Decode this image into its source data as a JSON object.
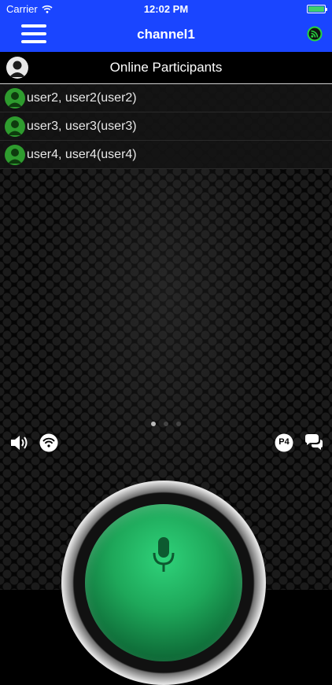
{
  "status_bar": {
    "carrier": "Carrier",
    "time": "12:02 PM"
  },
  "nav": {
    "title": "channel1",
    "menu_icon": "hamburger-icon",
    "signal_icon": "signal-icon"
  },
  "participants": {
    "title": "Online Participants",
    "users": [
      {
        "label": "user2, user2(user2)"
      },
      {
        "label": "user3, user3(user3)"
      },
      {
        "label": "user4, user4(user4)"
      }
    ]
  },
  "pager": {
    "pages": 3,
    "active": 0
  },
  "controls": {
    "p4_label": "P4"
  },
  "colors": {
    "nav_bg": "#1a45ff",
    "user_avatar": "#2e9b2e",
    "ptt_green": "#1ea85a"
  }
}
